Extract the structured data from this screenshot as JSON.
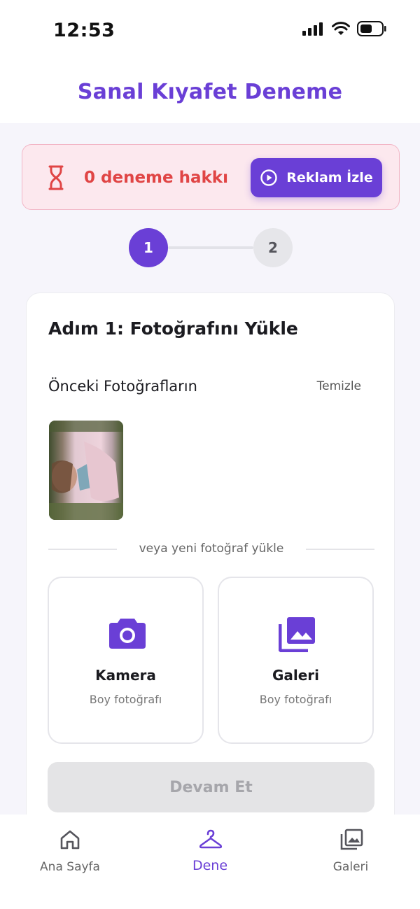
{
  "status_bar": {
    "time": "12:53",
    "icons": [
      "signal-icon",
      "wifi-icon",
      "battery-icon"
    ]
  },
  "header": {
    "title": "Sanal Kıyafet Deneme"
  },
  "credits": {
    "text": "0 deneme hakkı",
    "icon": "hourglass-icon",
    "button_label": "Reklam İzle",
    "button_icon": "play-circle-icon"
  },
  "stepper": {
    "steps": [
      "1",
      "2"
    ],
    "current": 1
  },
  "card": {
    "title": "Adım 1: Fotoğrafını Yükle",
    "previous_photos": {
      "title": "Önceki Fotoğrafların",
      "clear_label": "Temizle"
    },
    "divider_text": "veya yeni fotoğraf yükle",
    "upload_options": [
      {
        "label": "Kamera",
        "sublabel": "Boy fotoğrafı",
        "icon": "camera-icon"
      },
      {
        "label": "Galeri",
        "sublabel": "Boy fotoğrafı",
        "icon": "gallery-icon"
      }
    ],
    "continue_label": "Devam Et"
  },
  "bottom_nav": {
    "items": [
      {
        "label": "Ana Sayfa",
        "icon": "home-icon"
      },
      {
        "label": "Dene",
        "icon": "hanger-icon"
      },
      {
        "label": "Galeri",
        "icon": "gallery-icon"
      }
    ],
    "active": "Dene"
  },
  "colors": {
    "accent": "#6a3fd6",
    "warning": "#e04545",
    "warning_bg": "#fce8ee",
    "disabled_bg": "#e4e4e6"
  }
}
